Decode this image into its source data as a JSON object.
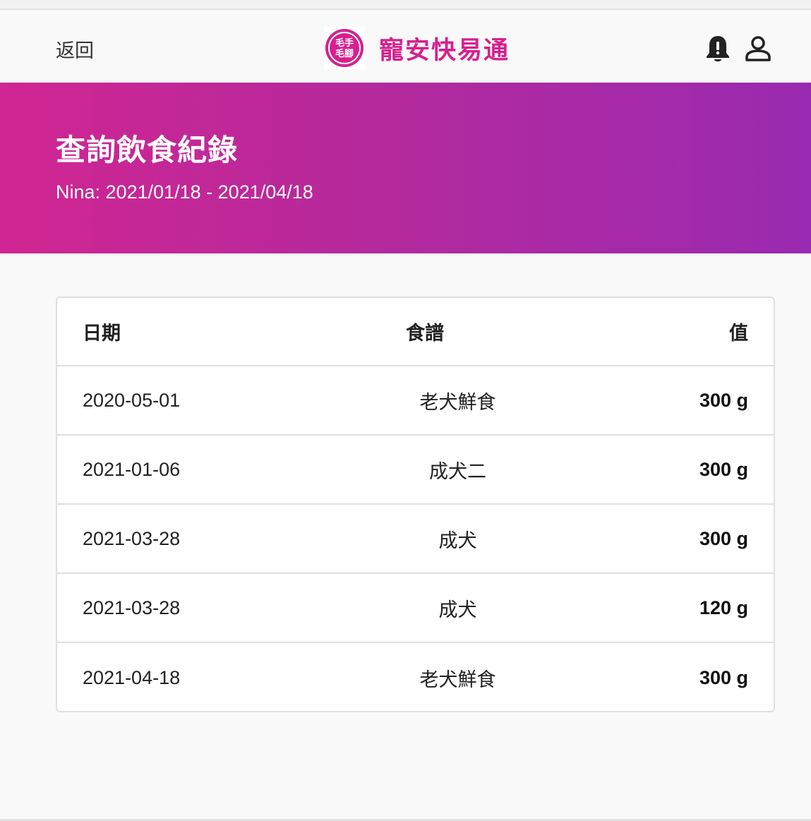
{
  "nav": {
    "back_label": "返回",
    "brand_name": "寵安快易通",
    "logo_text_top": "毛手",
    "logo_text_bottom": "毛腳",
    "icons": [
      "bell-icon",
      "user-icon"
    ],
    "brand_color": "#d6208f"
  },
  "hero": {
    "title": "查詢飲食紀錄",
    "subtitle": "Nina: 2021/01/18 - 2021/04/18",
    "gradient_start": "#d02592",
    "gradient_end": "#9a2ab1"
  },
  "table": {
    "columns": {
      "date": "日期",
      "recipe": "食譜",
      "value": "值"
    },
    "rows": [
      {
        "date": "2020-05-01",
        "recipe": "老犬鮮食",
        "value": "300 g"
      },
      {
        "date": "2021-01-06",
        "recipe": "成犬二",
        "value": "300 g"
      },
      {
        "date": "2021-03-28",
        "recipe": "成犬",
        "value": "300 g"
      },
      {
        "date": "2021-03-28",
        "recipe": "成犬",
        "value": "120 g"
      },
      {
        "date": "2021-04-18",
        "recipe": "老犬鮮食",
        "value": "300 g"
      }
    ]
  }
}
